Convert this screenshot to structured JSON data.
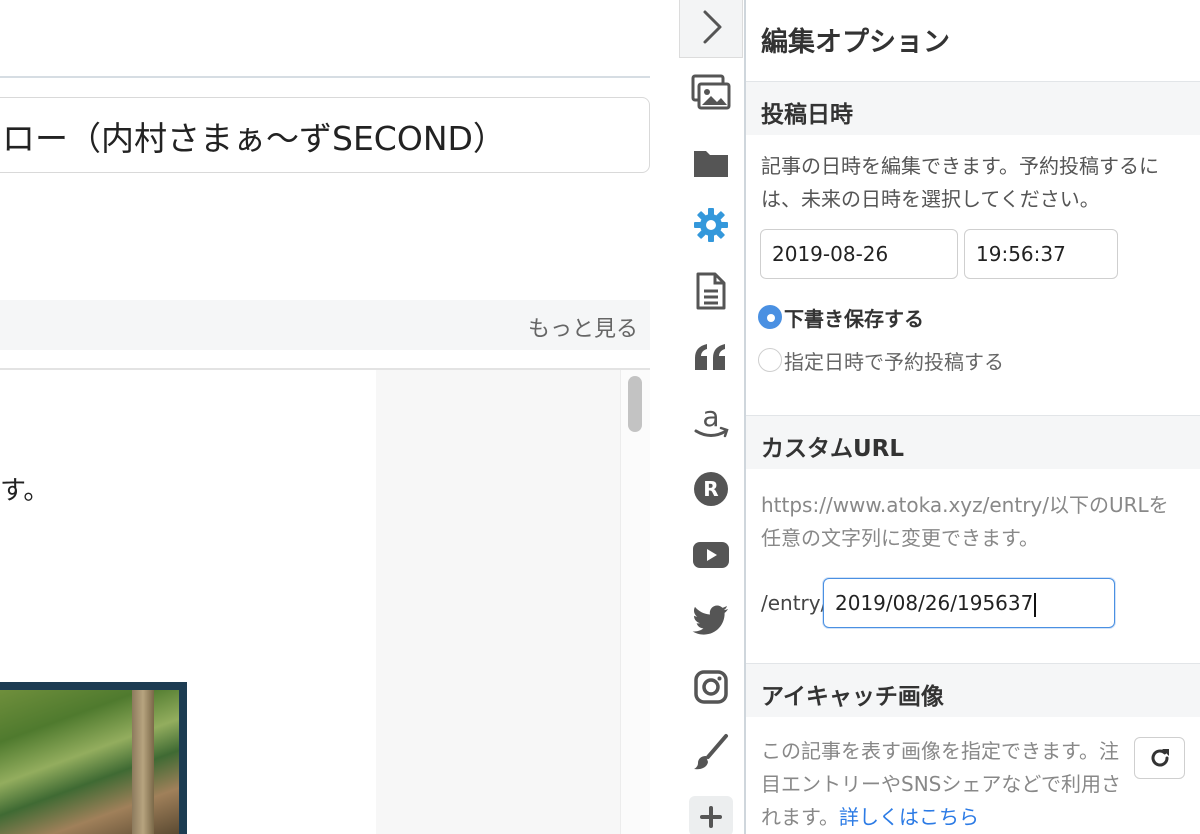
{
  "editor": {
    "title_text": "ロー（内村さまぁ〜ずSECOND）",
    "more_label": "もっと見る",
    "body_char": "す。"
  },
  "toolbar": {
    "icons": [
      "chevron-right-icon",
      "images-icon",
      "folder-icon",
      "gear-icon",
      "document-icon",
      "quote-icon",
      "amazon-icon",
      "rakuten-icon",
      "youtube-icon",
      "twitter-icon",
      "instagram-icon",
      "brush-icon",
      "plus-icon"
    ],
    "active_color": "#3498db"
  },
  "panel": {
    "title": "編集オプション",
    "post_date": {
      "heading": "投稿日時",
      "description": "記事の日時を編集できます。予約投稿するには、未来の日時を選択してください。",
      "date_value": "2019-08-26",
      "time_value": "19:56:37",
      "options": [
        {
          "label": "下書き保存する",
          "selected": true
        },
        {
          "label": "指定日時で予約投稿する",
          "selected": false
        }
      ]
    },
    "custom_url": {
      "heading": "カスタムURL",
      "description": "https://www.atoka.xyz/entry/以下のURLを任意の文字列に変更できます。",
      "prefix": "/entry/",
      "value": "2019/08/26/195637"
    },
    "eyecatch": {
      "heading": "アイキャッチ画像",
      "description": "この記事を表す画像を指定できます。注目エントリーやSNSシェアなどで利用されます。",
      "link_label": "詳しくはこちら"
    }
  },
  "colors": {
    "accent": "#4a90e2",
    "link": "#2c7be5"
  }
}
